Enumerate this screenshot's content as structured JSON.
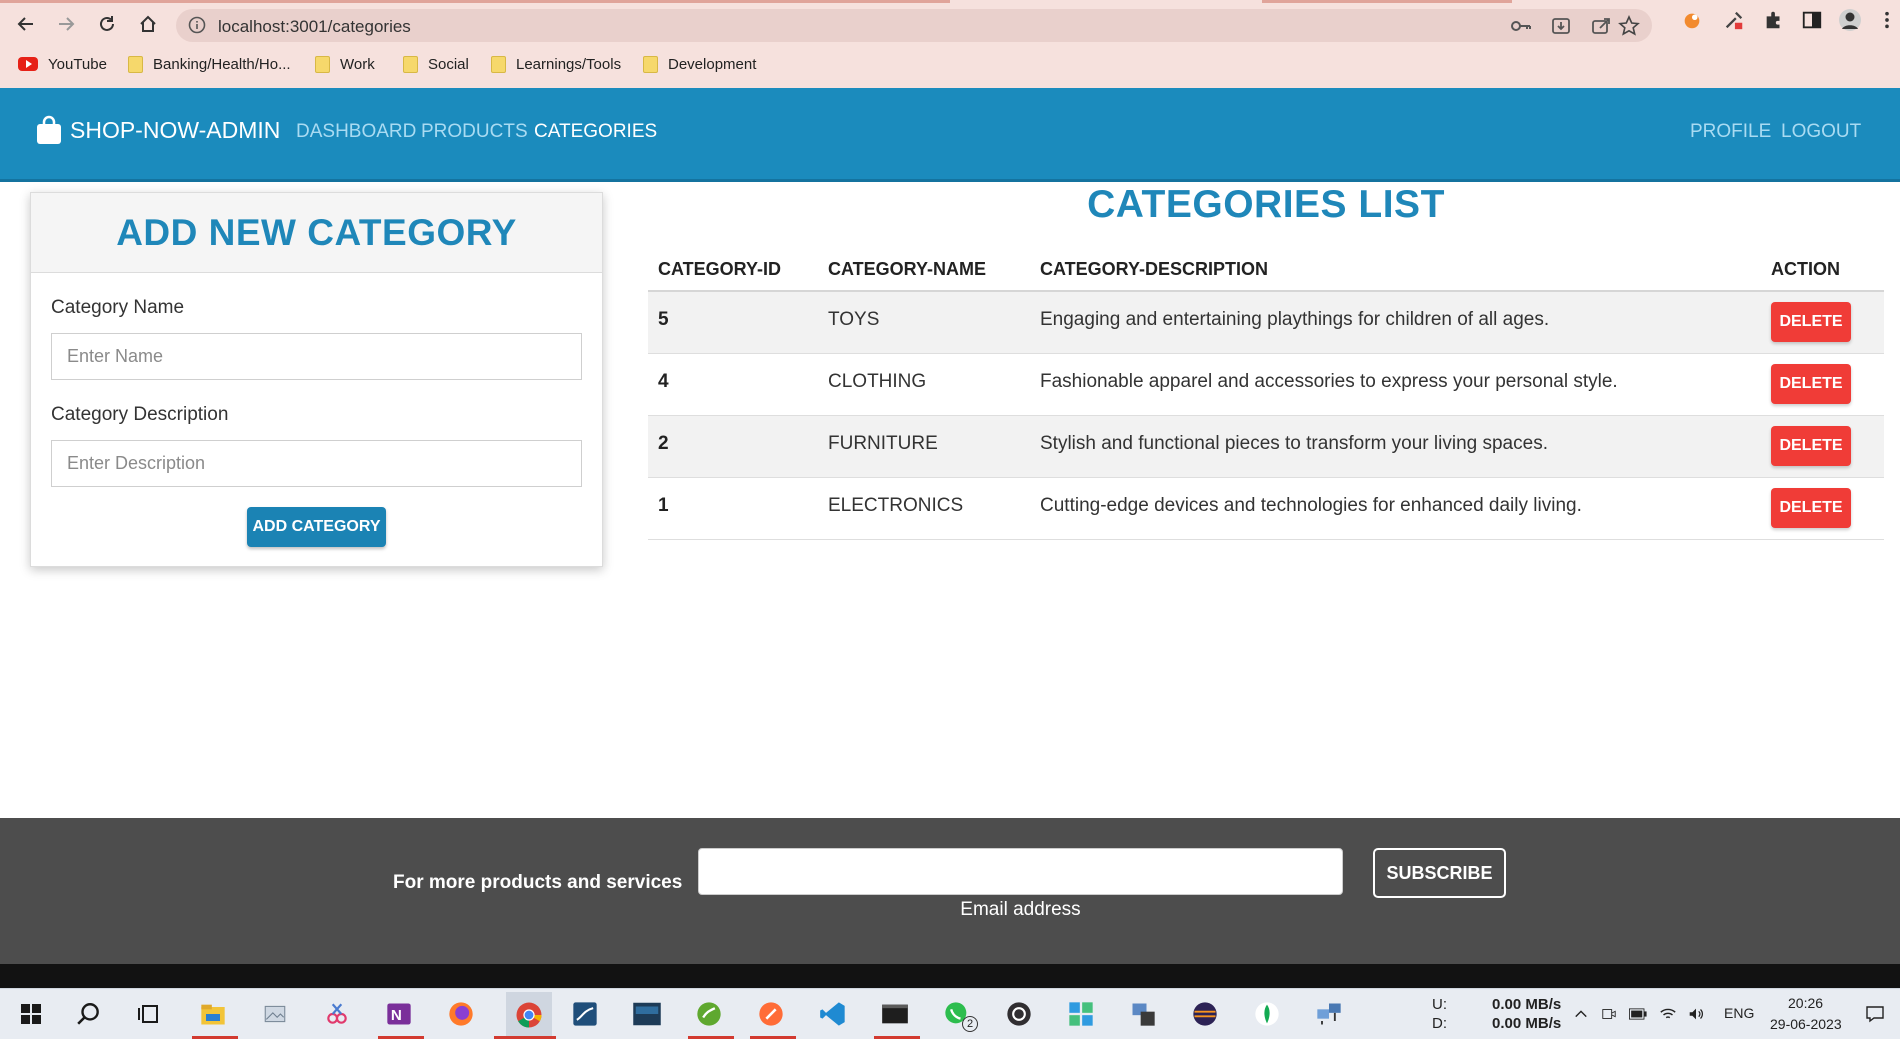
{
  "browser": {
    "url": "localhost:3001/categories",
    "bookmarks": [
      {
        "label": "YouTube",
        "icon": "youtube-icon"
      },
      {
        "label": "Banking/Health/Ho...",
        "icon": "folder-icon"
      },
      {
        "label": "Work",
        "icon": "folder-icon"
      },
      {
        "label": "Social",
        "icon": "folder-icon"
      },
      {
        "label": "Learnings/Tools",
        "icon": "folder-icon"
      },
      {
        "label": "Development",
        "icon": "folder-icon"
      }
    ]
  },
  "navbar": {
    "brand": "SHOP-NOW-ADMIN",
    "links": [
      {
        "label": "DASHBOARD",
        "active": false
      },
      {
        "label": "PRODUCTS",
        "active": false
      },
      {
        "label": "CATEGORIES",
        "active": true
      }
    ],
    "right_links": [
      {
        "label": "PROFILE"
      },
      {
        "label": "LOGOUT"
      }
    ],
    "color": "#1b8bbd"
  },
  "add_form": {
    "title": "ADD NEW CATEGORY",
    "name_label": "Category Name",
    "name_placeholder": "Enter Name",
    "name_value": "",
    "description_label": "Category Description",
    "description_placeholder": "Enter Description",
    "description_value": "",
    "submit_label": "ADD CATEGORY"
  },
  "list": {
    "title": "CATEGORIES LIST",
    "columns": [
      "CATEGORY-ID",
      "CATEGORY-NAME",
      "CATEGORY-DESCRIPTION",
      "ACTION"
    ],
    "rows": [
      {
        "id": "5",
        "name": "TOYS",
        "description": "Engaging and entertaining playthings for children of all ages.",
        "action": "DELETE"
      },
      {
        "id": "4",
        "name": "CLOTHING",
        "description": "Fashionable apparel and accessories to express your personal style.",
        "action": "DELETE"
      },
      {
        "id": "2",
        "name": "FURNITURE",
        "description": "Stylish and functional pieces to transform your living spaces.",
        "action": "DELETE"
      },
      {
        "id": "1",
        "name": "ELECTRONICS",
        "description": "Cutting-edge devices and technologies for enhanced daily living.",
        "action": "DELETE"
      }
    ],
    "delete_color": "#f03c37"
  },
  "footer": {
    "text": "For more products and services",
    "email_value": "",
    "email_label": "Email address",
    "subscribe_label": "SUBSCRIBE"
  },
  "taskbar": {
    "net_up_label": "U:",
    "net_down_label": "D:",
    "net_up": "0.00 MB/s",
    "net_down": "0.00 MB/s",
    "language": "ENG",
    "time": "20:26",
    "date": "29-06-2023",
    "whatsapp_badge": "2"
  }
}
